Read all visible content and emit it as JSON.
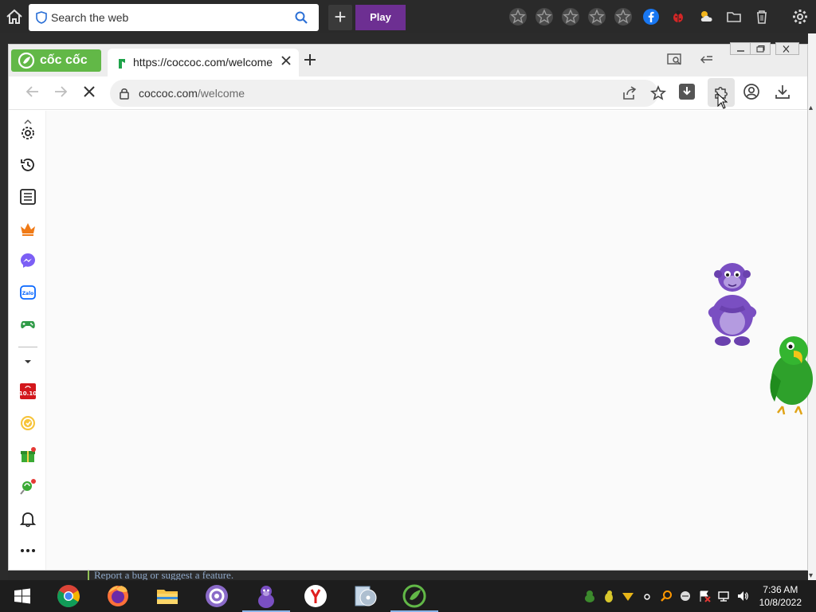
{
  "outer_bar": {
    "search_placeholder": "Search the web",
    "play_label": "Play"
  },
  "browser": {
    "brand": "cốc cốc",
    "tab_title": "https://coccoc.com/welcome",
    "url_host": "coccoc.com",
    "url_path": "/welcome",
    "loading": true
  },
  "sidebar": {
    "items": [
      "settings",
      "history",
      "reading-list",
      "crown",
      "messenger",
      "zalo",
      "games",
      "shopping-10-10",
      "coin",
      "gift",
      "lollipop",
      "notifications",
      "more"
    ]
  },
  "bottom_strip": {
    "report_text": "Report a bug or suggest a feature."
  },
  "taskbar": {
    "apps": [
      "start",
      "chrome",
      "firefox",
      "file-explorer",
      "opera-style",
      "bonzibuddy",
      "yandex",
      "disc-tool",
      "coccoc"
    ],
    "time": "7:36 AM",
    "date": "10/8/2022"
  },
  "colors": {
    "brand_green": "#62b847",
    "play_purple": "#6d2f92",
    "taskbar_bg": "#1d1d1d"
  }
}
